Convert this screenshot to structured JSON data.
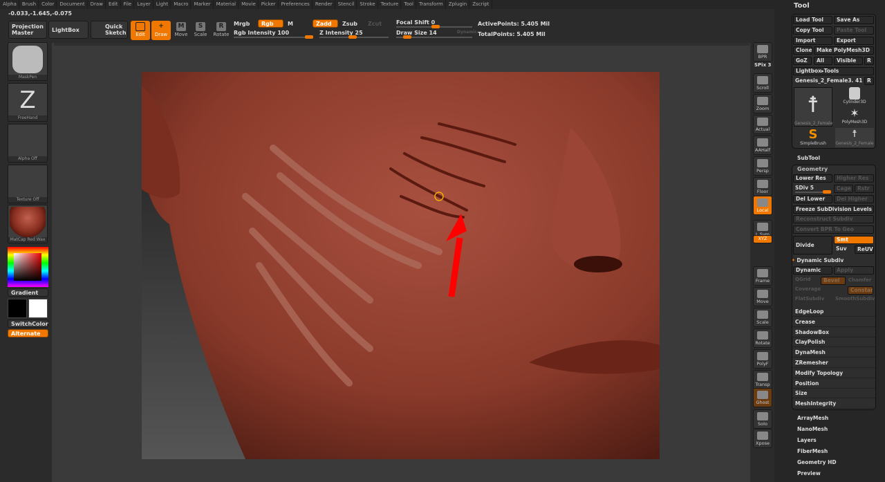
{
  "menu": [
    "Alpha",
    "Brush",
    "Color",
    "Document",
    "Draw",
    "Edit",
    "File",
    "Layer",
    "Light",
    "Macro",
    "Marker",
    "Material",
    "Movie",
    "Picker",
    "Preferences",
    "Render",
    "Stencil",
    "Stroke",
    "Texture",
    "Tool",
    "Transform",
    "Zplugin",
    "Zscript"
  ],
  "coords": "-0.033,-1.645,-0.075",
  "toolbar": {
    "projection_master": "Projection Master",
    "lightbox": "LightBox",
    "quick_sketch": "Quick Sketch",
    "edit": "Edit",
    "draw": "Draw",
    "move": "Move",
    "scale": "Scale",
    "rotate": "Rotate",
    "mrgb": "Mrgb",
    "rgb": "Rgb",
    "m": "M",
    "zadd": "Zadd",
    "zsub": "Zsub",
    "zcut": "Zcut",
    "rgb_intensity": "Rgb Intensity 100",
    "z_intensity": "Z Intensity 25",
    "focal_shift": "Focal Shift 0",
    "draw_size": "Draw Size 14",
    "dynamic": "Dynamic",
    "active_points": "ActivePoints: 5.405 Mil",
    "total_points": "TotalPoints: 5.405 Mil",
    "rgb_intensity_value": 100,
    "z_intensity_value": 25,
    "focal_shift_value": 0,
    "draw_size_value": 14
  },
  "left_shelf": {
    "brush": "MaskPen",
    "stroke": "FreeHand",
    "alpha": "Alpha Off",
    "texture": "Texture Off",
    "material": "MatCap Red Wax",
    "gradient": "Gradient",
    "switch_color": "SwitchColor",
    "alternate": "Alternate",
    "main_color": "#000000",
    "secondary_color": "#ffffff"
  },
  "right_shelf": [
    {
      "label": "BPR"
    },
    {
      "label": "SPix 3"
    },
    {
      "label": "Scroll"
    },
    {
      "label": "Zoom"
    },
    {
      "label": "Actual"
    },
    {
      "label": "AAHalf"
    },
    {
      "label": "Persp"
    },
    {
      "label": "Floor"
    },
    {
      "label": "Local"
    },
    {
      "label": "L.Sym"
    },
    {
      "label": "XYZ"
    },
    {
      "label": "Frame"
    },
    {
      "label": "Move"
    },
    {
      "label": "Scale"
    },
    {
      "label": "Rotate"
    },
    {
      "label": "PolyF"
    },
    {
      "label": "Transp"
    },
    {
      "label": "Ghost"
    },
    {
      "label": "Solo"
    },
    {
      "label": "Xpose"
    }
  ],
  "tool": {
    "title": "Tool",
    "load_tool": "Load Tool",
    "save_as": "Save As",
    "copy_tool": "Copy Tool",
    "paste_tool": "Paste Tool",
    "import": "Import",
    "export": "Export",
    "clone": "Clone",
    "make_polymesh": "Make PolyMesh3D",
    "goz": "GoZ",
    "all": "All",
    "visible": "Visible",
    "r": "R",
    "lightbox_tools": "Lightbox▸Tools",
    "current_tool": "Genesis_2_Female3. 41",
    "thumbs": [
      "Genesis_2_Female",
      "Cylinder3D",
      "PolyMesh3D",
      "SimpleBrush",
      "Genesis_2_Female"
    ],
    "subtool": "SubTool"
  },
  "geometry": {
    "title": "Geometry",
    "lower_res": "Lower Res",
    "higher_res": "Higher Res",
    "sdiv": "SDiv 5",
    "cage": "Cage",
    "rstr": "Rstr",
    "del_lower": "Del Lower",
    "del_higher": "Del Higher",
    "freeze": "Freeze SubDivision Levels",
    "reconstruct": "Reconstruct Subdiv",
    "convert_bpr": "Convert BPR To Geo",
    "divide": "Divide",
    "smt": "Smt",
    "suv": "Suv",
    "reuv": "ReUV",
    "dynamic_subdiv": "Dynamic Subdiv",
    "dynamic": "Dynamic",
    "apply": "Apply",
    "qgrid": "QGrid",
    "bevel": "Bevel",
    "chamfer": "Chamfer",
    "coverage": "Coverage",
    "constant": "Constant",
    "flatsubdiv": "FlatSubdiv",
    "smoothsubdiv": "SmoothSubdiv",
    "items": [
      "EdgeLoop",
      "Crease",
      "ShadowBox",
      "ClayPolish",
      "DynaMesh",
      "ZRemesher",
      "Modify Topology",
      "Position",
      "Size",
      "MeshIntegrity"
    ]
  },
  "tool_sections": [
    "ArrayMesh",
    "NanoMesh",
    "Layers",
    "FiberMesh",
    "Geometry HD",
    "Preview"
  ],
  "colors": {
    "accent": "#f07800",
    "skin": "#8a3a2a",
    "arrow": "#ff0000"
  }
}
